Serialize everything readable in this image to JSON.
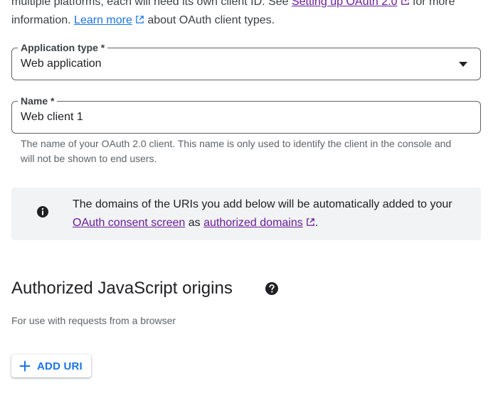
{
  "intro": {
    "line1_prefix": "multiple platforms, each will need its own client ID. See ",
    "line1_link": "Setting up OAuth 2.0",
    "line1_suffix": " for more",
    "line2_prefix": "information. ",
    "line2_link": "Learn more",
    "line2_suffix": " about OAuth client types."
  },
  "application_type": {
    "label": "Application type *",
    "value": "Web application"
  },
  "name_field": {
    "label": "Name *",
    "value": "Web client 1",
    "helper": "The name of your OAuth 2.0 client. This name is only used to identify the client in the console and will not be shown to end users."
  },
  "info_box": {
    "icon": "info-icon",
    "text_prefix": "The domains of the URIs you add below will be automatically added to your ",
    "link1": "OAuth consent screen",
    "text_middle": " as ",
    "link2": "authorized domains",
    "text_suffix": "."
  },
  "js_origins": {
    "title": "Authorized JavaScript origins",
    "help_icon": "help-icon",
    "subtitle": "For use with requests from a browser",
    "add_button": "ADD URI"
  },
  "colors": {
    "link_purple": "#6a1b9a",
    "accent_blue": "#1a73e8",
    "info_bg": "#f1f3f4"
  }
}
